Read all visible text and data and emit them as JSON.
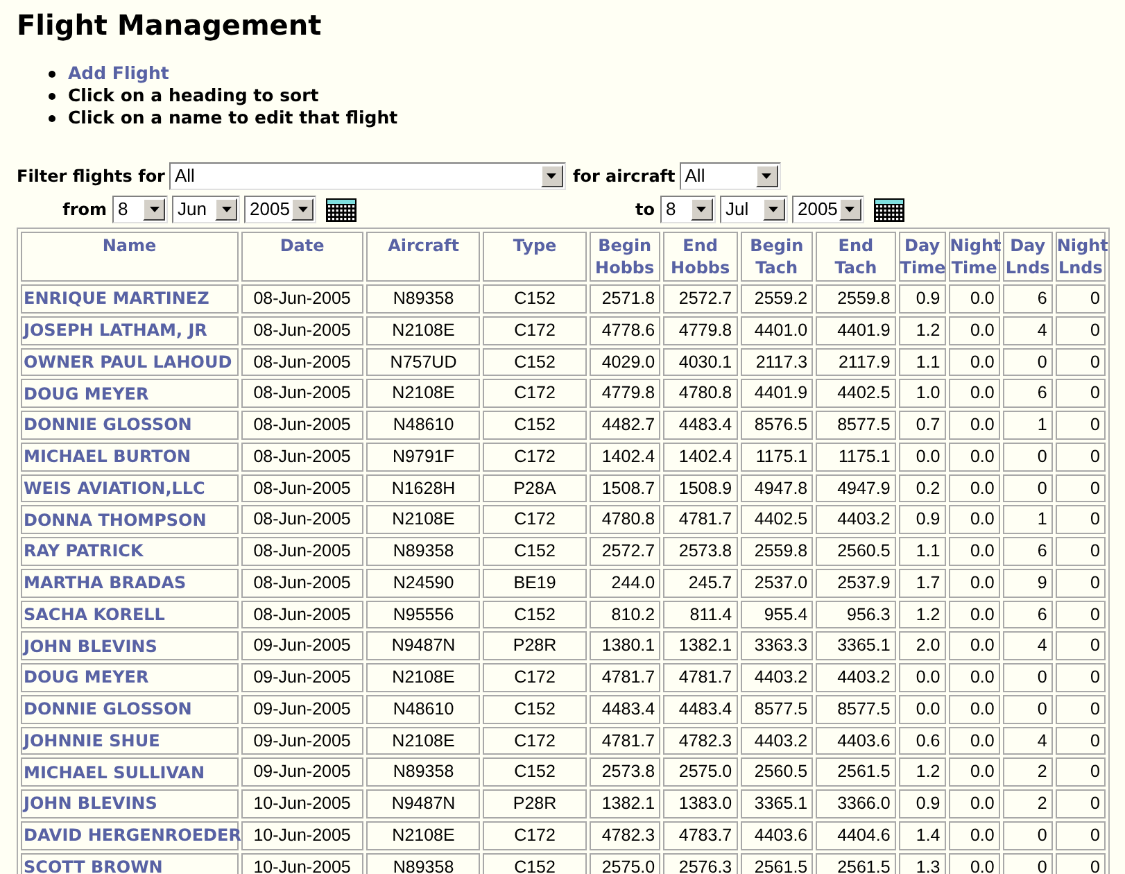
{
  "title": "Flight Management",
  "instructions": [
    {
      "kind": "link",
      "text": "Add Flight"
    },
    {
      "kind": "text",
      "text": "Click on a heading to sort"
    },
    {
      "kind": "text",
      "text": "Click on a name to edit that flight"
    }
  ],
  "filter": {
    "label": "Filter flights for",
    "person": {
      "value": "All"
    },
    "aircraft_label": "for aircraft",
    "aircraft": {
      "value": "All"
    },
    "from_label": "from",
    "from": [
      {
        "value": "8"
      },
      {
        "value": "Jun"
      },
      {
        "value": "2005"
      }
    ],
    "to_label": "to",
    "to": [
      {
        "value": "8"
      },
      {
        "value": "Jul"
      },
      {
        "value": "2005"
      }
    ]
  },
  "table": {
    "columns": [
      "Name",
      "Date",
      "Aircraft",
      "Type",
      "Begin Hobbs",
      "End Hobbs",
      "Begin Tach",
      "End Tach",
      "Day Time",
      "Night Time",
      "Day Lnds",
      "Night Lnds"
    ],
    "rows": [
      [
        "ENRIQUE MARTINEZ",
        "08-Jun-2005",
        "N89358",
        "C152",
        "2571.8",
        "2572.7",
        "2559.2",
        "2559.8",
        "0.9",
        "0.0",
        "6",
        "0"
      ],
      [
        "JOSEPH LATHAM, JR",
        "08-Jun-2005",
        "N2108E",
        "C172",
        "4778.6",
        "4779.8",
        "4401.0",
        "4401.9",
        "1.2",
        "0.0",
        "4",
        "0"
      ],
      [
        "OWNER PAUL LAHOUD",
        "08-Jun-2005",
        "N757UD",
        "C152",
        "4029.0",
        "4030.1",
        "2117.3",
        "2117.9",
        "1.1",
        "0.0",
        "0",
        "0"
      ],
      [
        "DOUG MEYER",
        "08-Jun-2005",
        "N2108E",
        "C172",
        "4779.8",
        "4780.8",
        "4401.9",
        "4402.5",
        "1.0",
        "0.0",
        "6",
        "0"
      ],
      [
        "DONNIE GLOSSON",
        "08-Jun-2005",
        "N48610",
        "C152",
        "4482.7",
        "4483.4",
        "8576.5",
        "8577.5",
        "0.7",
        "0.0",
        "1",
        "0"
      ],
      [
        "MICHAEL BURTON",
        "08-Jun-2005",
        "N9791F",
        "C172",
        "1402.4",
        "1402.4",
        "1175.1",
        "1175.1",
        "0.0",
        "0.0",
        "0",
        "0"
      ],
      [
        "WEIS AVIATION,LLC",
        "08-Jun-2005",
        "N1628H",
        "P28A",
        "1508.7",
        "1508.9",
        "4947.8",
        "4947.9",
        "0.2",
        "0.0",
        "0",
        "0"
      ],
      [
        "DONNA THOMPSON",
        "08-Jun-2005",
        "N2108E",
        "C172",
        "4780.8",
        "4781.7",
        "4402.5",
        "4403.2",
        "0.9",
        "0.0",
        "1",
        "0"
      ],
      [
        "RAY PATRICK",
        "08-Jun-2005",
        "N89358",
        "C152",
        "2572.7",
        "2573.8",
        "2559.8",
        "2560.5",
        "1.1",
        "0.0",
        "6",
        "0"
      ],
      [
        "MARTHA BRADAS",
        "08-Jun-2005",
        "N24590",
        "BE19",
        "244.0",
        "245.7",
        "2537.0",
        "2537.9",
        "1.7",
        "0.0",
        "9",
        "0"
      ],
      [
        "SACHA KORELL",
        "08-Jun-2005",
        "N95556",
        "C152",
        "810.2",
        "811.4",
        "955.4",
        "956.3",
        "1.2",
        "0.0",
        "6",
        "0"
      ],
      [
        "JOHN BLEVINS",
        "09-Jun-2005",
        "N9487N",
        "P28R",
        "1380.1",
        "1382.1",
        "3363.3",
        "3365.1",
        "2.0",
        "0.0",
        "4",
        "0"
      ],
      [
        "DOUG MEYER",
        "09-Jun-2005",
        "N2108E",
        "C172",
        "4781.7",
        "4781.7",
        "4403.2",
        "4403.2",
        "0.0",
        "0.0",
        "0",
        "0"
      ],
      [
        "DONNIE GLOSSON",
        "09-Jun-2005",
        "N48610",
        "C152",
        "4483.4",
        "4483.4",
        "8577.5",
        "8577.5",
        "0.0",
        "0.0",
        "0",
        "0"
      ],
      [
        "JOHNNIE SHUE",
        "09-Jun-2005",
        "N2108E",
        "C172",
        "4781.7",
        "4782.3",
        "4403.2",
        "4403.6",
        "0.6",
        "0.0",
        "4",
        "0"
      ],
      [
        "MICHAEL SULLIVAN",
        "09-Jun-2005",
        "N89358",
        "C152",
        "2573.8",
        "2575.0",
        "2560.5",
        "2561.5",
        "1.2",
        "0.0",
        "2",
        "0"
      ],
      [
        "JOHN BLEVINS",
        "10-Jun-2005",
        "N9487N",
        "P28R",
        "1382.1",
        "1383.0",
        "3365.1",
        "3366.0",
        "0.9",
        "0.0",
        "2",
        "0"
      ],
      [
        "DAVID HERGENROEDER",
        "10-Jun-2005",
        "N2108E",
        "C172",
        "4782.3",
        "4783.7",
        "4403.6",
        "4404.6",
        "1.4",
        "0.0",
        "0",
        "0"
      ],
      [
        "SCOTT BROWN",
        "10-Jun-2005",
        "N89358",
        "C152",
        "2575.0",
        "2576.3",
        "2561.5",
        "2561.5",
        "1.3",
        "0.0",
        "0",
        "0"
      ]
    ]
  }
}
